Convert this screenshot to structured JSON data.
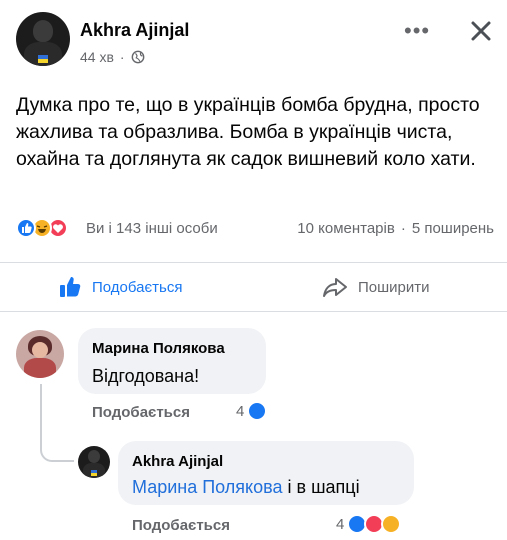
{
  "post": {
    "author": "Akhra Ajinjal",
    "time": "44 хв",
    "separator": "·",
    "text": "Думка про те, що в українців бомба брудна, просто жахлива та образлива. Бомба  в українців чиста, охайна та доглянута як садок вишневий коло хати.",
    "more_icon": "more-icon",
    "close_icon": "close-icon",
    "globe_icon": "globe-icon"
  },
  "stats": {
    "reactions": [
      "like",
      "haha",
      "love"
    ],
    "reaction_text": "Ви і 143 інші особи",
    "comments": "10 коментарів",
    "dot": "·",
    "shares": "5 поширень"
  },
  "actions": {
    "like_label": "Подобається",
    "share_label": "Поширити"
  },
  "comments": [
    {
      "author": "Марина Полякова",
      "text": "Відгодована!",
      "like_label": "Подобається",
      "reaction_count": "4"
    }
  ],
  "reply": {
    "author": "Akhra Ajinjal",
    "mention": "Марина Полякова",
    "text": " і в шапці",
    "like_label": "Подобається",
    "reaction_count": "4"
  },
  "colors": {
    "accent": "#1877f2",
    "muted": "#65676b",
    "bubble": "#f0f2f5",
    "love": "#f33e58",
    "haha": "#f7b125"
  }
}
